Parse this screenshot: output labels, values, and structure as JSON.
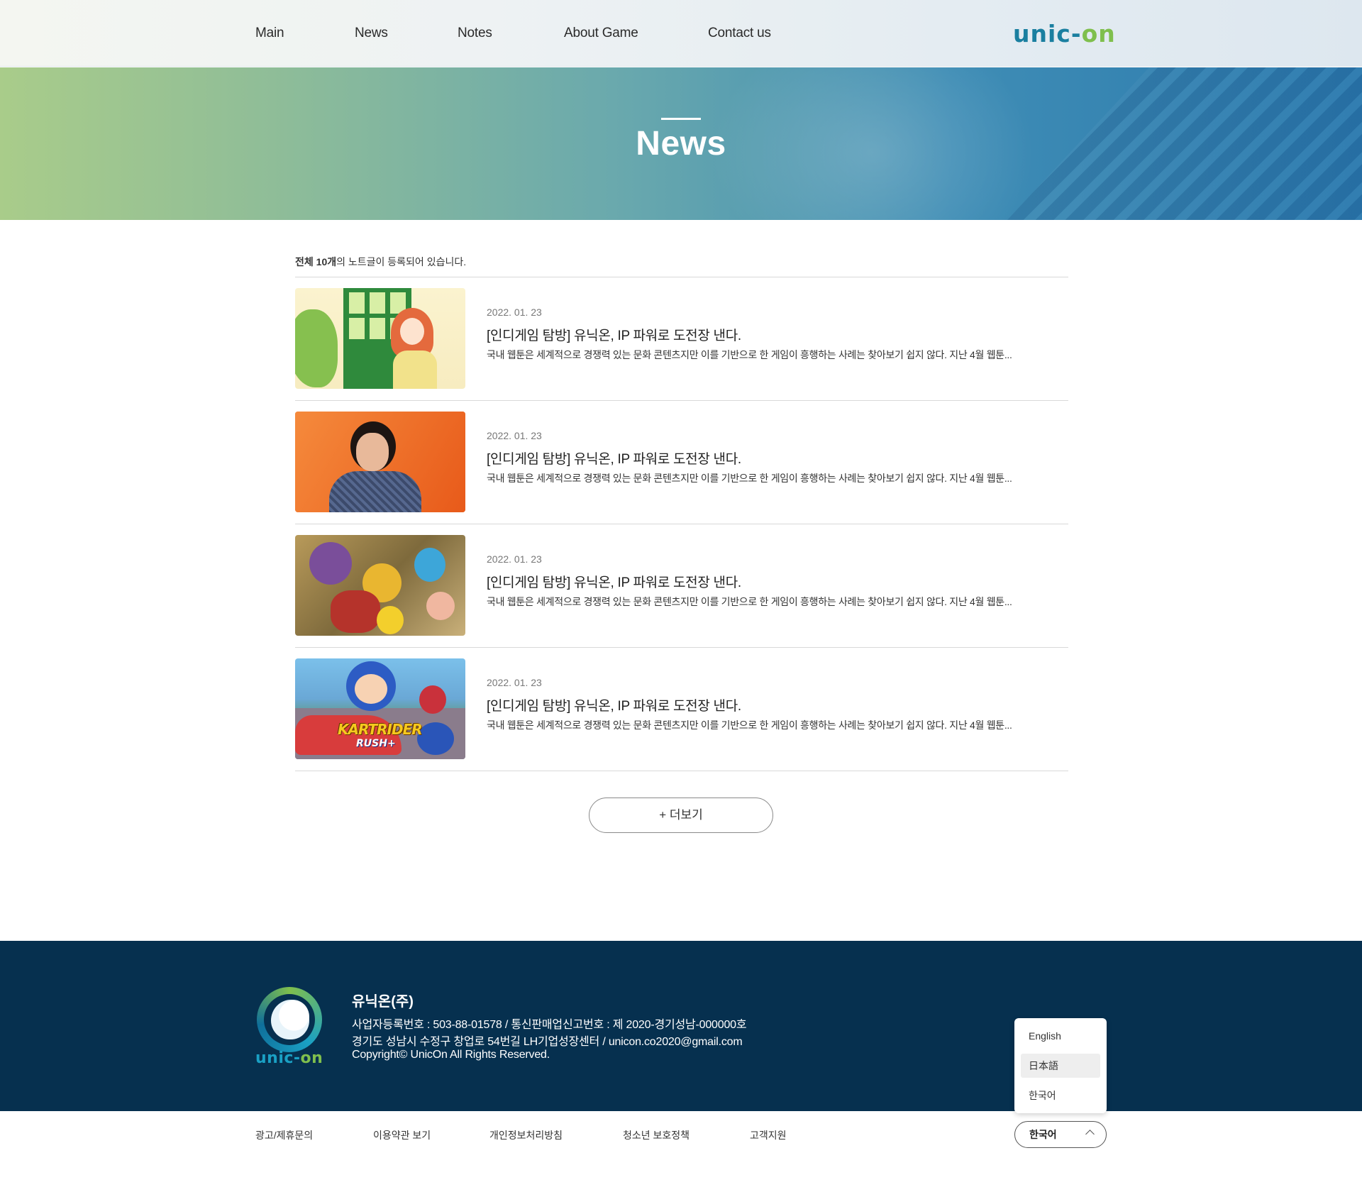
{
  "nav": {
    "items": [
      "Main",
      "News",
      "Notes",
      "About Game",
      "Contact us"
    ],
    "logo": {
      "prefix": "unic-",
      "suffix": "on"
    }
  },
  "hero": {
    "title": "News"
  },
  "list": {
    "count_prefix": "전체 ",
    "count_number": "10개",
    "count_suffix": "의 노트글이 등록되어 있습니다.",
    "items": [
      {
        "date": "2022. 01. 23",
        "title": "[인디게임 탐방] 유닉온, IP 파워로 도전장 낸다.",
        "desc": "국내 웹툰은 세계적으로 경쟁력 있는 문화 콘텐츠지만 이를 기반으로 한 게임이 흥행하는 사례는 찾아보기 쉽지 않다. 지난 4월 웹툰..."
      },
      {
        "date": "2022. 01. 23",
        "title": "[인디게임 탐방] 유닉온, IP 파워로 도전장 낸다.",
        "desc": "국내 웹툰은 세계적으로 경쟁력 있는 문화 콘텐츠지만 이를 기반으로 한 게임이 흥행하는 사례는 찾아보기 쉽지 않다. 지난 4월 웹툰..."
      },
      {
        "date": "2022. 01. 23",
        "title": "[인디게임 탐방] 유닉온, IP 파워로 도전장 낸다.",
        "desc": "국내 웹툰은 세계적으로 경쟁력 있는 문화 콘텐츠지만 이를 기반으로 한 게임이 흥행하는 사례는 찾아보기 쉽지 않다. 지난 4월 웹툰..."
      },
      {
        "date": "2022. 01. 23",
        "title": "[인디게임 탐방] 유닉온, IP 파워로 도전장 낸다.",
        "desc": "국내 웹툰은 세계적으로 경쟁력 있는 문화 콘텐츠지만 이를 기반으로 한 게임이 흥행하는 사례는 찾아보기 쉽지 않다. 지난 4월 웹툰..."
      }
    ],
    "thumb4_text": {
      "line1": "KARTRIDER",
      "line2": "RUSH+"
    },
    "more_label": "+ 더보기"
  },
  "footer": {
    "logo": {
      "prefix": "unic-",
      "suffix": "on"
    },
    "company": "유닉온(주)",
    "line1": "사업자등록번호 : 503-88-01578  /  통신판매업신고번호 : 제 2020-경기성남-000000호",
    "line2": "경기도 성남시 수정구 창업로 54번길 LH기업성장센터  /  unicon.co2020@gmail.com",
    "line3": "Copyright© UnicOn  All Rights Reserved.",
    "links": [
      "광고/제휴문의",
      "이용약관 보기",
      "개인정보처리방침",
      "청소년 보호정책",
      "고객지원"
    ],
    "language": {
      "options": [
        "English",
        "日本語",
        "한국어"
      ],
      "selected_option": "日本語",
      "current": "한국어"
    }
  },
  "colors": {
    "brand_blue": "#1a7fa0",
    "brand_green": "#7fbf4d",
    "footer_bg": "#06304f"
  }
}
